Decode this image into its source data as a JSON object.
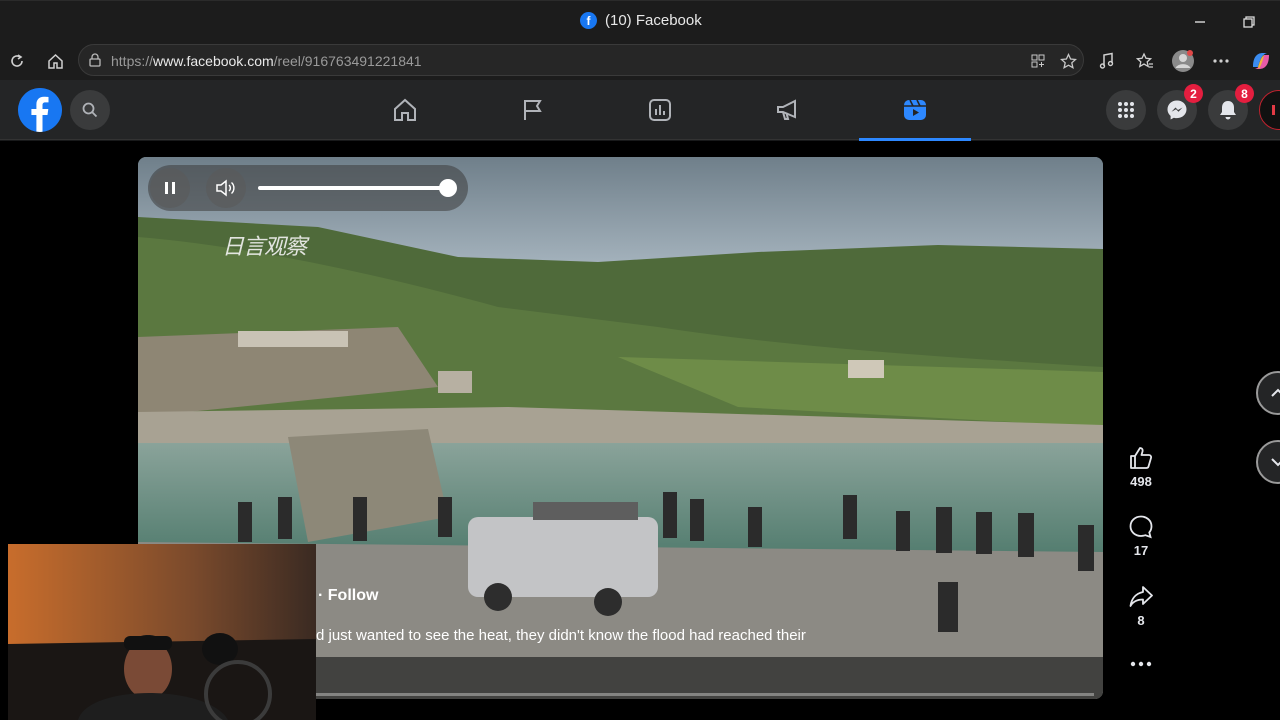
{
  "browser": {
    "tab_title": "(10) Facebook",
    "favicon_letter": "f",
    "url_prefix": "https://",
    "url_domain": "www.facebook.com",
    "url_path": "/reel/916763491221841"
  },
  "fb_nav": {
    "tabs": [
      {
        "name": "home",
        "icon": "home-icon"
      },
      {
        "name": "pages",
        "icon": "flag-icon"
      },
      {
        "name": "insights",
        "icon": "chart-icon"
      },
      {
        "name": "ads",
        "icon": "megaphone-icon"
      },
      {
        "name": "reels",
        "icon": "reels-icon",
        "active": true
      }
    ],
    "messenger_badge": "2",
    "notifications_badge": "8",
    "accent_color": "#2d88ff"
  },
  "video": {
    "watermark": "日言观察",
    "follow_label": "· Follow",
    "caption": "d just wanted to see the heat, they didn't know the flood had reached their",
    "volume_level": 1.0
  },
  "actions": {
    "likes": "498",
    "comments": "17",
    "shares": "8"
  }
}
